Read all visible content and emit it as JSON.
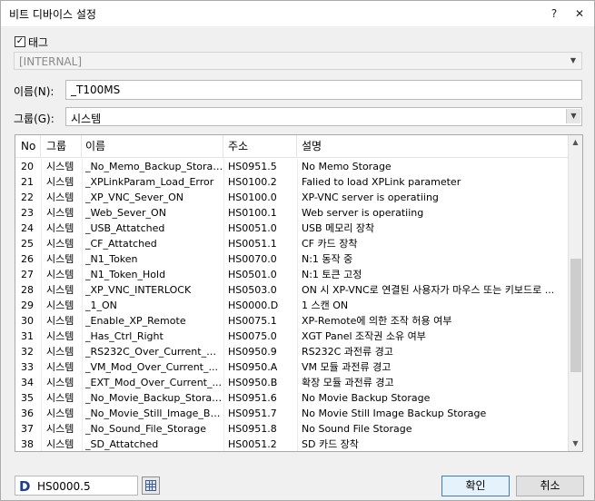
{
  "title": "비트 디바이스 설정",
  "titlebar": {
    "help": "?",
    "close": "✕"
  },
  "tag": {
    "checked": true,
    "check_mark": "✓",
    "label": "태그",
    "combo_value": "[INTERNAL]"
  },
  "name": {
    "label": "이름(N):",
    "value": "_T100MS"
  },
  "group": {
    "label": "그룹(G):",
    "value": "시스템"
  },
  "table": {
    "headers": {
      "no": "No",
      "group": "그룹",
      "name": "이름",
      "address": "주소",
      "description": "설명"
    },
    "rows": [
      {
        "no": "20",
        "group": "시스템",
        "name": "_No_Memo_Backup_Storage",
        "address": "HS0951.5",
        "desc": "No Memo Storage"
      },
      {
        "no": "21",
        "group": "시스템",
        "name": "_XPLinkParam_Load_Error",
        "address": "HS0100.2",
        "desc": "Falied to load XPLink parameter"
      },
      {
        "no": "22",
        "group": "시스템",
        "name": "_XP_VNC_Sever_ON",
        "address": "HS0100.0",
        "desc": "XP-VNC server is operatiing"
      },
      {
        "no": "23",
        "group": "시스템",
        "name": "_Web_Sever_ON",
        "address": "HS0100.1",
        "desc": "Web server is operatiing"
      },
      {
        "no": "24",
        "group": "시스템",
        "name": "_USB_Attatched",
        "address": "HS0051.0",
        "desc": "USB 메모리 장착"
      },
      {
        "no": "25",
        "group": "시스템",
        "name": "_CF_Attatched",
        "address": "HS0051.1",
        "desc": "CF 카드 장착"
      },
      {
        "no": "26",
        "group": "시스템",
        "name": "_N1_Token",
        "address": "HS0070.0",
        "desc": "N:1 동작 중"
      },
      {
        "no": "27",
        "group": "시스템",
        "name": "_N1_Token_Hold",
        "address": "HS0501.0",
        "desc": "N:1 토큰 고정"
      },
      {
        "no": "28",
        "group": "시스템",
        "name": "_XP_VNC_INTERLOCK",
        "address": "HS0503.0",
        "desc": "ON 시 XP-VNC로 연결된 사용자가 마우스 또는 키보드로 ..."
      },
      {
        "no": "29",
        "group": "시스템",
        "name": "_1_ON",
        "address": "HS0000.D",
        "desc": "1 스캔 ON"
      },
      {
        "no": "30",
        "group": "시스템",
        "name": "_Enable_XP_Remote",
        "address": "HS0075.1",
        "desc": "XP-Remote에 의한 조작 허용 여부"
      },
      {
        "no": "31",
        "group": "시스템",
        "name": "_Has_Ctrl_Right",
        "address": "HS0075.0",
        "desc": "XGT Panel 조작권 소유 여부"
      },
      {
        "no": "32",
        "group": "시스템",
        "name": "_RS232C_Over_Current_W...",
        "address": "HS0950.9",
        "desc": "RS232C 과전류 경고"
      },
      {
        "no": "33",
        "group": "시스템",
        "name": "_VM_Mod_Over_Current_...",
        "address": "HS0950.A",
        "desc": "VM 모듈 과전류 경고"
      },
      {
        "no": "34",
        "group": "시스템",
        "name": "_EXT_Mod_Over_Current_...",
        "address": "HS0950.B",
        "desc": "확장 모듈 과전류 경고"
      },
      {
        "no": "35",
        "group": "시스템",
        "name": "_No_Movie_Backup_Storage",
        "address": "HS0951.6",
        "desc": "No Movie Backup Storage"
      },
      {
        "no": "36",
        "group": "시스템",
        "name": "_No_Movie_Still_Image_Bac...",
        "address": "HS0951.7",
        "desc": "No Movie Still Image Backup Storage"
      },
      {
        "no": "37",
        "group": "시스템",
        "name": "_No_Sound_File_Storage",
        "address": "HS0951.8",
        "desc": "No Sound File Storage"
      },
      {
        "no": "38",
        "group": "시스템",
        "name": "_SD_Attatched",
        "address": "HS0051.2",
        "desc": "SD 카드 장착"
      }
    ]
  },
  "scroll_position": 0.63,
  "address": {
    "prefix": "D",
    "value": "HS0000.5"
  },
  "buttons": {
    "ok": "확인",
    "cancel": "취소"
  }
}
